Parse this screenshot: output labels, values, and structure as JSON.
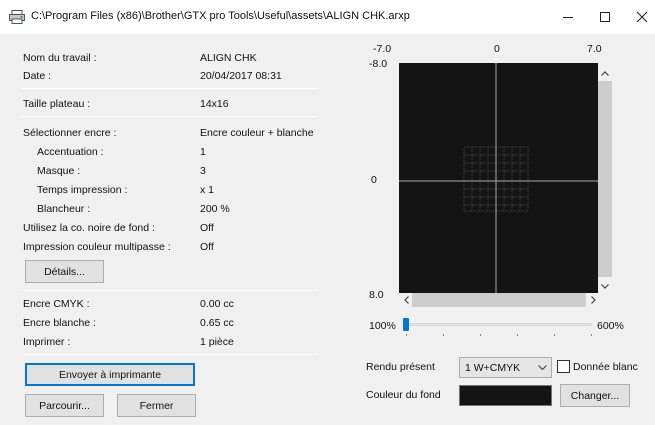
{
  "window": {
    "title": "C:\\Program Files (x86)\\Brother\\GTX pro Tools\\Useful\\assets\\ALIGN CHK.arxp",
    "minimize_label": "–",
    "maximize_label": "☐",
    "close_label": "✕"
  },
  "job_info": {
    "job_name_label": "Nom du travail :",
    "job_name_value": "ALIGN CHK",
    "date_label": "Date :",
    "date_value": "20/04/2017 08:31",
    "platen_label": "Taille plateau :",
    "platen_value": "14x16"
  },
  "ink_settings": {
    "select_ink_label": "Sélectionner encre :",
    "select_ink_value": "Encre couleur + blanche",
    "highlight_label": "Accentuation :",
    "highlight_value": "1",
    "mask_label": "Masque :",
    "mask_value": "3",
    "print_time_label": "Temps impression :",
    "print_time_value": "x 1",
    "whiteness_label": "Blancheur :",
    "whiteness_value": "200 %",
    "black_bg_label": "Utilisez la co. noire de fond :",
    "black_bg_value": "Off",
    "multipass_label": "Impression couleur multipasse :",
    "multipass_value": "Off",
    "details_button": "Détails..."
  },
  "consumption": {
    "cmyk_label": "Encre CMYK :",
    "cmyk_value": "0.00 cc",
    "white_label": "Encre blanche :",
    "white_value": "0.65 cc",
    "print_label": "Imprimer :",
    "print_value": "1 pièce"
  },
  "actions": {
    "send_button": "Envoyer à imprimante",
    "browse_button": "Parcourir...",
    "close_button": "Fermer"
  },
  "preview": {
    "x_min_label": "-7.0",
    "x_mid_label": "0",
    "x_max_label": "7.0",
    "y_top_label": "-8.0",
    "y_mid_label": "0",
    "y_bottom_label": "8.0",
    "zoom_min_label": "100%",
    "zoom_max_label": "600%",
    "zoom_fraction": 0
  },
  "render": {
    "rendu_label": "Rendu présent",
    "rendu_value": "1 W+CMYK",
    "white_data_label": "Donnée blanc",
    "white_data_checked": false,
    "bg_color_label": "Couleur du fond",
    "bg_color": "#141414",
    "change_button": "Changer..."
  },
  "icons": {
    "app": "printer-icon",
    "select_caret": "chevron-down-icon"
  }
}
